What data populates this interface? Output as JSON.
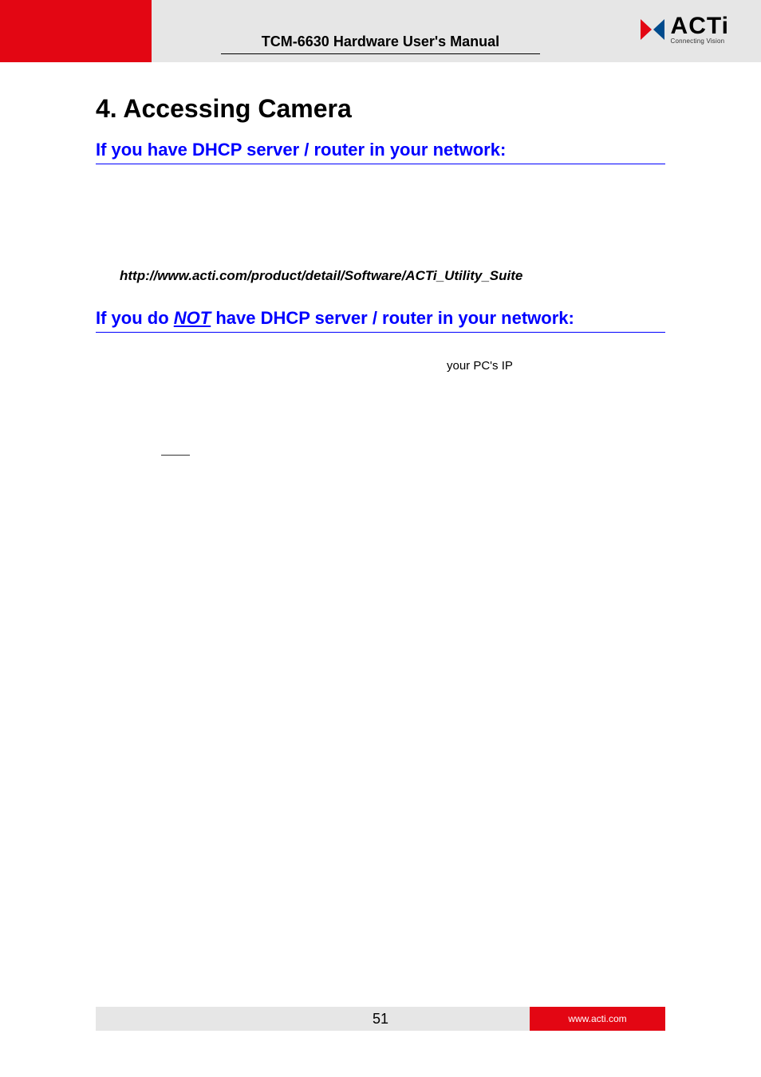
{
  "header": {
    "title": "TCM-6630 Hardware User's Manual",
    "logo_text": "ACTi",
    "logo_tagline": "Connecting Vision"
  },
  "content": {
    "chapter_title": "4. Accessing Camera",
    "section1_title": "If you have DHCP server / router in your network:",
    "link_line": "http://www.acti.com/product/detail/Software/ACTi_Utility_Suite",
    "section2_prefix": "If you do ",
    "section2_not": "NOT",
    "section2_suffix": " have DHCP server / router in your network:",
    "pc_ip_text": "your PC's IP"
  },
  "footer": {
    "page_number": "51",
    "site": "www.acti.com"
  },
  "colors": {
    "brand_red": "#e30613",
    "header_gray": "#e6e6e6",
    "link_blue": "#0000ff"
  }
}
